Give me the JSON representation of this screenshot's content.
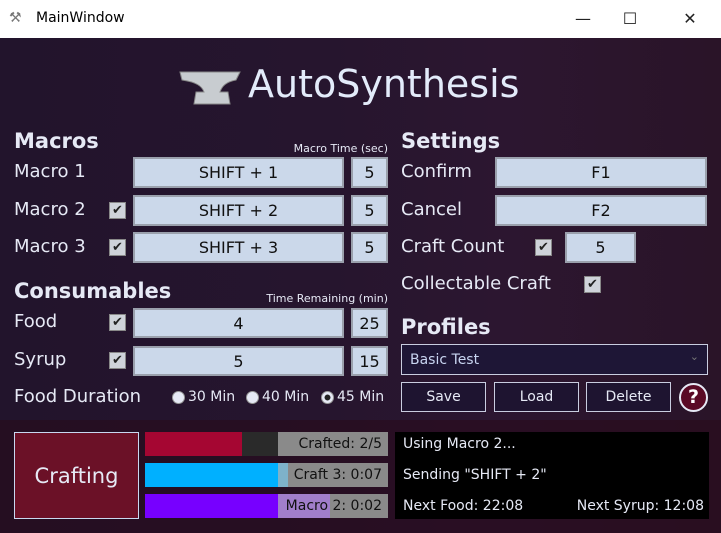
{
  "window": {
    "title": "MainWindow",
    "minimize": "—",
    "maximize": "☐",
    "close": "✕"
  },
  "app": {
    "title": "AutoSynthesis",
    "logo_icon": "anvil-icon"
  },
  "macros": {
    "heading": "Macros",
    "time_header": "Macro Time (sec)",
    "rows": [
      {
        "label": "Macro 1",
        "key": "SHIFT + 1",
        "time": "5",
        "has_checkbox": false
      },
      {
        "label": "Macro 2",
        "key": "SHIFT + 2",
        "time": "5",
        "checked": true
      },
      {
        "label": "Macro 3",
        "key": "SHIFT + 3",
        "time": "5",
        "checked": true
      }
    ]
  },
  "consumables": {
    "heading": "Consumables",
    "time_header": "Time Remaining (min)",
    "rows": [
      {
        "label": "Food",
        "key": "4",
        "time": "25",
        "checked": true
      },
      {
        "label": "Syrup",
        "key": "5",
        "time": "15",
        "checked": true
      }
    ],
    "food_duration": {
      "label": "Food Duration",
      "options": [
        "30 Min",
        "40 Min",
        "45 Min"
      ],
      "selected": "45 Min"
    }
  },
  "settings": {
    "heading": "Settings",
    "confirm_label": "Confirm",
    "confirm_value": "F1",
    "cancel_label": "Cancel",
    "cancel_value": "F2",
    "craft_count_label": "Craft Count",
    "craft_count_checked": true,
    "craft_count_value": "5",
    "collectable_label": "Collectable Craft",
    "collectable_checked": true
  },
  "profiles": {
    "heading": "Profiles",
    "selected": "Basic Test",
    "save": "Save",
    "load": "Load",
    "delete": "Delete",
    "help": "?"
  },
  "status": {
    "button": "Crafting",
    "bars": [
      {
        "label": "Crafted: 2/5",
        "progress": 0.4,
        "color": "#a50632"
      },
      {
        "label": "Craft 3: 0:07",
        "progress": 0.59,
        "color": "#00b0ff"
      },
      {
        "label": "Macro 2: 0:02",
        "progress": 0.76,
        "color": "#7700ff"
      }
    ],
    "line1": "Using Macro 2...",
    "line2": "Sending \"SHIFT + 2\"",
    "next_food": "Next Food: 22:08",
    "next_syrup": "Next Syrup: 12:08"
  }
}
